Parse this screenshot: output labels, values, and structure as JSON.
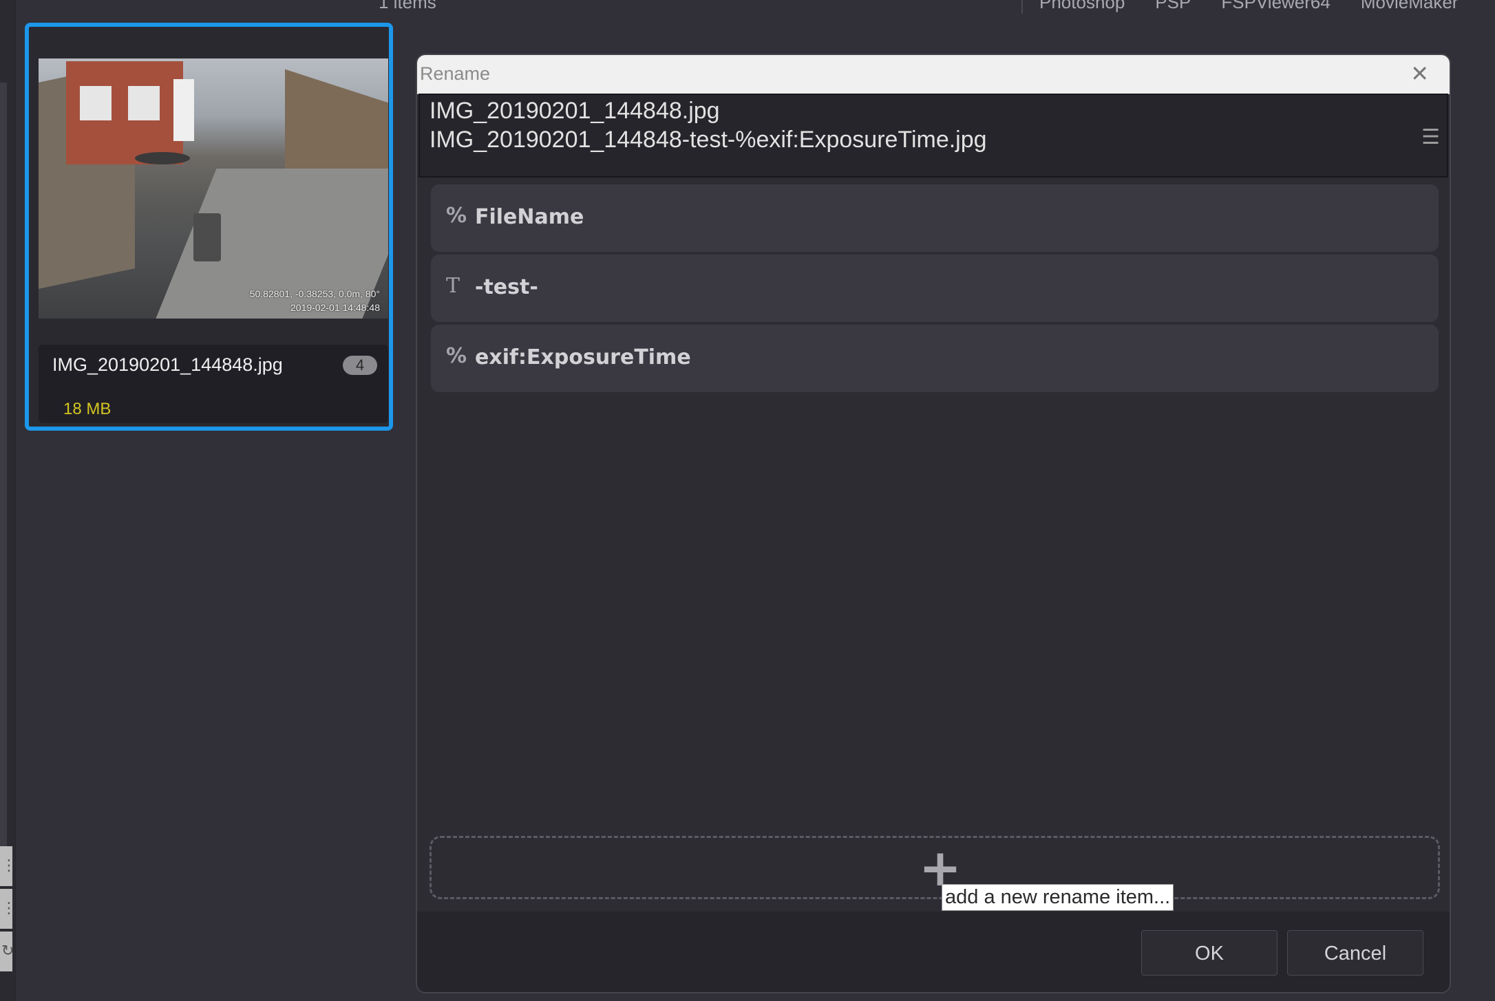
{
  "header": {
    "items_count": "1 items",
    "apps": [
      "Photoshop",
      "PSP",
      "FSPViewer64",
      "MovieMaker"
    ]
  },
  "thumbnail": {
    "file_name": "IMG_20190201_144848.jpg",
    "badge_count": "4",
    "file_size": "18 MB",
    "photo_stamp_line1": "50.82801, -0.38253, 0.0m, 80°",
    "photo_stamp_line2": "2019-02-01 14:48:48",
    "selection_color": "#1c97ea",
    "size_color": "#d4c621"
  },
  "dialog": {
    "title": "Rename",
    "close_icon": "close-icon",
    "preview": {
      "original": "IMG_20190201_144848.jpg",
      "renamed": "IMG_20190201_144848-test-%exif:ExposureTime.jpg",
      "menu_icon": "hamburger-menu-icon"
    },
    "rename_items": [
      {
        "icon": "%",
        "icon_name": "variable-icon",
        "label": "FileName"
      },
      {
        "icon": "T",
        "icon_name": "text-icon",
        "label": "-test-"
      },
      {
        "icon": "%",
        "icon_name": "variable-icon",
        "label": "exif:ExposureTime"
      }
    ],
    "add_item_tooltip": "add a new rename item...",
    "ok_label": "OK",
    "cancel_label": "Cancel"
  }
}
